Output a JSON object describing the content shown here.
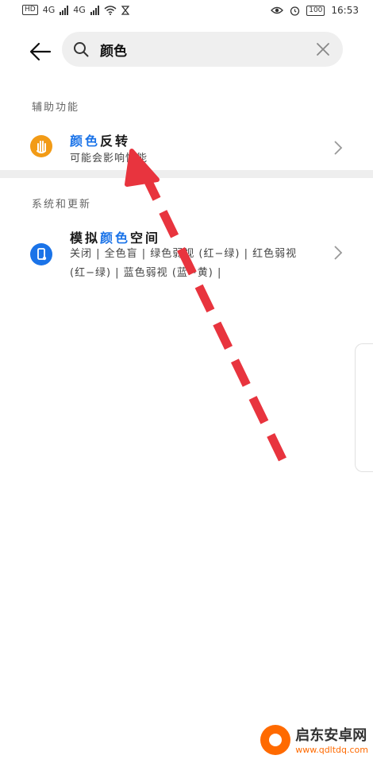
{
  "status_bar": {
    "network_badge": "HD",
    "signal1": "4G",
    "signal2": "4G",
    "battery": "100",
    "time": "16:53"
  },
  "search": {
    "query": "颜色",
    "icon": "search-icon",
    "clear_icon": "close-icon"
  },
  "sections": [
    {
      "title": "辅助功能",
      "item": {
        "title_pre": "",
        "title_hl": "颜色",
        "title_post": "反转",
        "subtitle": "可能会影响性能",
        "icon": "hand-icon",
        "icon_color": "#f29b16"
      }
    },
    {
      "title": "系统和更新",
      "item": {
        "title_pre": "模拟",
        "title_hl": "颜色",
        "title_post": "空间",
        "subtitle_line1": "关闭 | 全色盲 | 绿色弱视 (红−绿) | 红色弱视",
        "subtitle_line2": "(红−绿) | 蓝色弱视 (蓝−黄) |",
        "icon": "phone-icon",
        "icon_color": "#1a73e8"
      }
    }
  ],
  "watermark": {
    "name": "启东安卓网",
    "url": "www.qdltdq.com"
  }
}
